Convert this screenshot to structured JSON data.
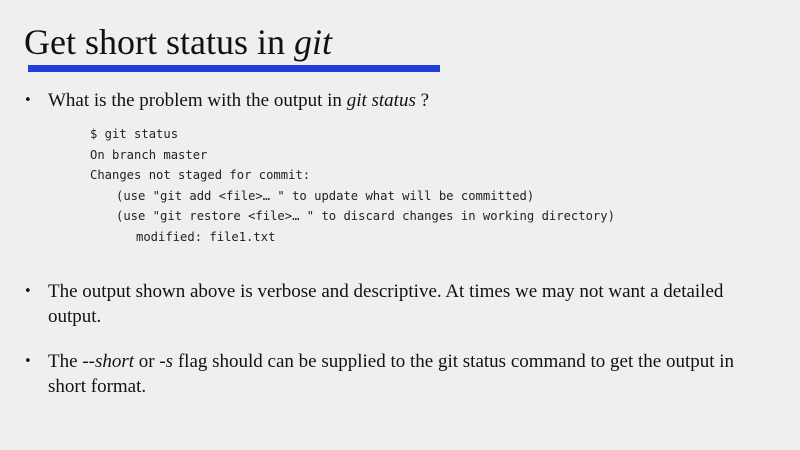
{
  "title": {
    "prefix": "Get short status in ",
    "italic": "git"
  },
  "bullets": [
    {
      "before": "What is the problem with the output in ",
      "italic": "git status",
      "after": " ?"
    },
    {
      "text": "The output shown above is verbose and descriptive. At times we may not want a detailed output."
    },
    {
      "before": "The ",
      "italic1": "--short",
      "middle": " or ",
      "italic2": "-s",
      "after": " flag should can be supplied to the git status command to get the output in short format."
    }
  ],
  "code_lines": [
    "$ git status",
    "On branch master",
    "Changes not staged for commit:",
    "(use \"git add <file>… \" to update what will be committed)",
    "(use \"git restore <file>… \" to discard changes in working directory)",
    "modified: file1.txt"
  ],
  "bullet_glyph": "•",
  "colors": {
    "accent_underline": "#1f3fd6",
    "background": "#efefef"
  }
}
